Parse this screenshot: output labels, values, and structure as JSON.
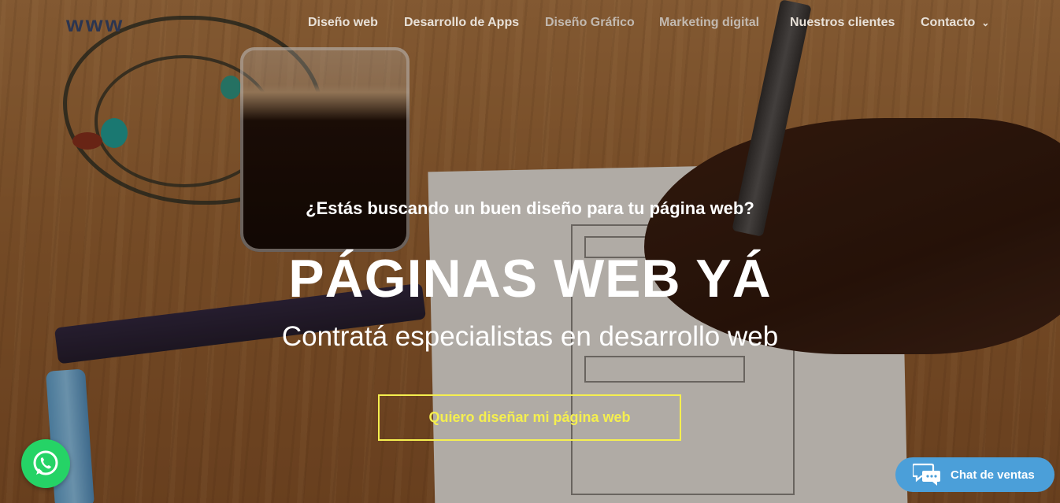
{
  "brand": {
    "logo_text": "www"
  },
  "nav": {
    "items": [
      {
        "label": "Diseño web"
      },
      {
        "label": "Desarrollo de Apps"
      },
      {
        "label": "Diseño Gráfico"
      },
      {
        "label": "Marketing digital"
      },
      {
        "label": "Nuestros clientes"
      },
      {
        "label": "Contacto"
      }
    ]
  },
  "hero": {
    "question": "¿Estás buscando un buen diseño para tu página web?",
    "title": "PÁGINAS WEB YÁ",
    "subtitle": "Contratá especialistas en desarrollo web",
    "cta_label": "Quiero diseñar mi página web"
  },
  "widgets": {
    "chat_label": "Chat de ventas"
  },
  "icons": {
    "whatsapp": "whatsapp-icon",
    "chat": "chat-bubbles-icon",
    "dropdown": "chevron-down-icon"
  },
  "colors": {
    "cta_accent": "#f5ef4f",
    "whatsapp_green": "#25d366",
    "chat_blue": "#4b9fd9"
  }
}
